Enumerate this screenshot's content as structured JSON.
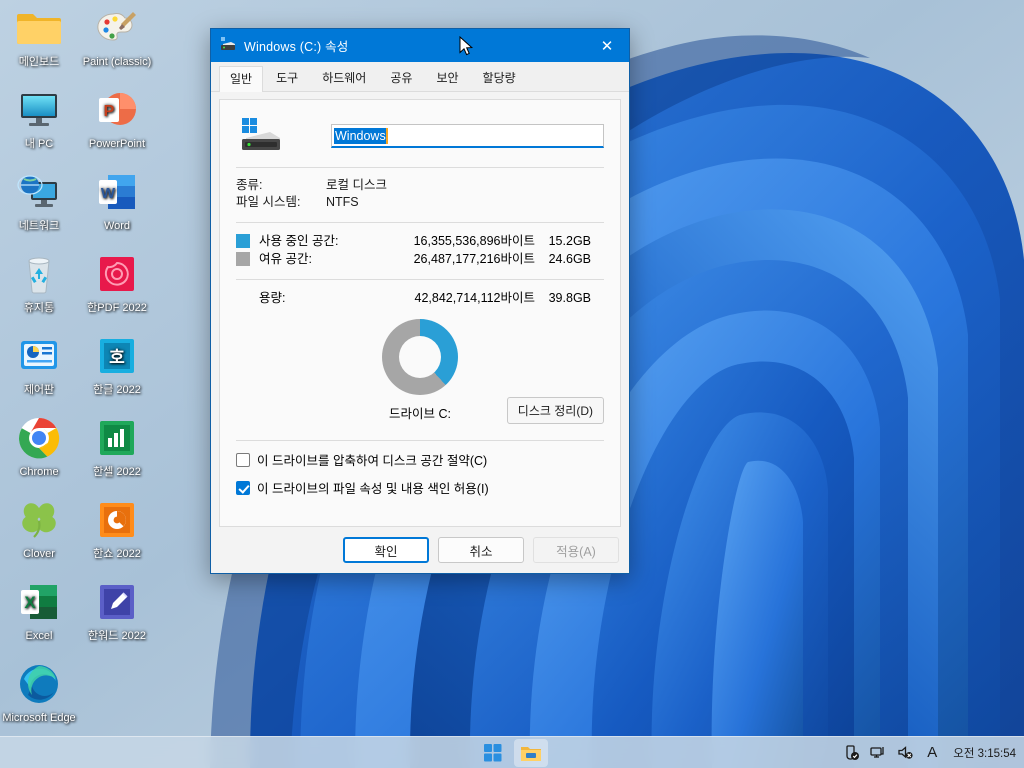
{
  "desktop": {
    "icons": [
      {
        "label": "메인보드",
        "icon": "folder-icon",
        "col": 0,
        "row": 0
      },
      {
        "label": "내 PC",
        "icon": "this-pc-icon",
        "col": 0,
        "row": 1
      },
      {
        "label": "네트워크",
        "icon": "network-icon",
        "col": 0,
        "row": 2
      },
      {
        "label": "휴지통",
        "icon": "recycle-bin-icon",
        "col": 0,
        "row": 3
      },
      {
        "label": "제어판",
        "icon": "control-panel-icon",
        "col": 0,
        "row": 4
      },
      {
        "label": "Chrome",
        "icon": "chrome-icon",
        "col": 0,
        "row": 5
      },
      {
        "label": "Clover",
        "icon": "clover-icon",
        "col": 0,
        "row": 6
      },
      {
        "label": "Excel",
        "icon": "excel-icon",
        "col": 0,
        "row": 7
      },
      {
        "label": "Microsoft Edge",
        "icon": "edge-icon",
        "col": 0,
        "row": 8
      },
      {
        "label": "Paint (classic)",
        "icon": "paint-icon",
        "col": 1,
        "row": 0
      },
      {
        "label": "PowerPoint",
        "icon": "powerpoint-icon",
        "col": 1,
        "row": 1
      },
      {
        "label": "Word",
        "icon": "word-icon",
        "col": 1,
        "row": 2
      },
      {
        "label": "한PDF 2022",
        "icon": "hanpdf-icon",
        "col": 1,
        "row": 3
      },
      {
        "label": "한글 2022",
        "icon": "hangul-icon",
        "col": 1,
        "row": 4
      },
      {
        "label": "한셀 2022",
        "icon": "hancell-icon",
        "col": 1,
        "row": 5
      },
      {
        "label": "한쇼 2022",
        "icon": "hanshow-icon",
        "col": 1,
        "row": 6
      },
      {
        "label": "한워드 2022",
        "icon": "hanword-icon",
        "col": 1,
        "row": 7
      }
    ]
  },
  "dialog": {
    "title": "Windows (C:) 속성",
    "title_icon": "drive-icon",
    "close_label": "✕",
    "tabs": [
      {
        "label": "일반",
        "active": true
      },
      {
        "label": "도구",
        "active": false
      },
      {
        "label": "하드웨어",
        "active": false
      },
      {
        "label": "공유",
        "active": false
      },
      {
        "label": "보안",
        "active": false
      },
      {
        "label": "할당량",
        "active": false
      }
    ],
    "volume_name": "Windows",
    "info": [
      {
        "key": "종류:",
        "value": "로컬 디스크"
      },
      {
        "key": "파일 시스템:",
        "value": "NTFS"
      }
    ],
    "usage": [
      {
        "label": "사용 중인 공간:",
        "bytes": "16,355,536,896바이트",
        "gb": "15.2GB",
        "color": "#2a9fd6"
      },
      {
        "label": "여유 공간:",
        "bytes": "26,487,177,216바이트",
        "gb": "24.6GB",
        "color": "#a6a6a6"
      }
    ],
    "capacity": {
      "label": "용량:",
      "bytes": "42,842,714,112바이트",
      "gb": "39.8GB"
    },
    "drive_caption": "드라이브 C:",
    "cleanup_button": "디스크 정리(D)",
    "checkboxes": [
      {
        "label": "이 드라이브를 압축하여 디스크 공간 절약(C)",
        "checked": false
      },
      {
        "label": "이 드라이브의 파일 속성 및 내용 색인 허용(I)",
        "checked": true
      }
    ],
    "buttons": [
      {
        "label": "확인",
        "style": "default"
      },
      {
        "label": "취소",
        "style": "normal"
      },
      {
        "label": "적용(A)",
        "style": "disabled"
      }
    ],
    "colors": {
      "titlebar": "#0078d7",
      "used": "#2a9fd6",
      "free": "#a6a6a6",
      "accent": "#0078d7"
    }
  },
  "chart_data": {
    "type": "pie",
    "title": "드라이브 C:",
    "categories": [
      "사용 중인 공간",
      "여유 공간"
    ],
    "values": [
      15.2,
      24.6
    ],
    "units": "GB",
    "bytes": [
      16355536896,
      26487177216
    ],
    "total_bytes": 42842714112,
    "total_gb": 39.8,
    "percentages": [
      38.2,
      61.8
    ],
    "colors": [
      "#2a9fd6",
      "#a6a6a6"
    ],
    "legend": "left",
    "donut": true
  },
  "taskbar": {
    "buttons": [
      {
        "name": "start-button",
        "icon": "windows-logo-icon",
        "active": false
      },
      {
        "name": "file-explorer-button",
        "icon": "folder-icon",
        "active": true
      }
    ],
    "tray": [
      {
        "name": "security-shield-icon",
        "glyph": "shield"
      },
      {
        "name": "network-icon",
        "glyph": "network"
      },
      {
        "name": "speaker-muted-icon",
        "glyph": "speaker"
      },
      {
        "name": "ime-indicator",
        "glyph": "A"
      }
    ],
    "clock": "오전 3:15:54"
  }
}
